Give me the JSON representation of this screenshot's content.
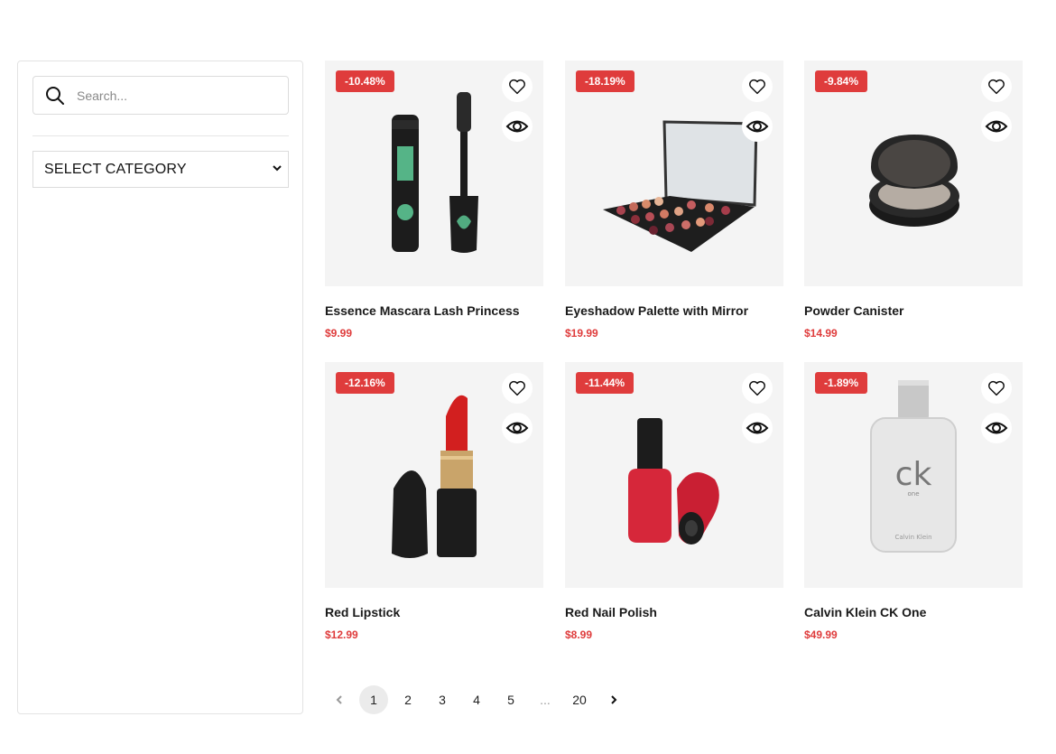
{
  "sidebar": {
    "search_placeholder": "Search...",
    "category_select": "SELECT CATEGORY"
  },
  "products": [
    {
      "name": "Essence Mascara Lash Princess",
      "price": "$9.99",
      "discount": "-10.48%",
      "icon": "mascara"
    },
    {
      "name": "Eyeshadow Palette with Mirror",
      "price": "$19.99",
      "discount": "-18.19%",
      "icon": "eyeshadow-palette"
    },
    {
      "name": "Powder Canister",
      "price": "$14.99",
      "discount": "-9.84%",
      "icon": "powder-compact"
    },
    {
      "name": "Red Lipstick",
      "price": "$12.99",
      "discount": "-12.16%",
      "icon": "lipstick"
    },
    {
      "name": "Red Nail Polish",
      "price": "$8.99",
      "discount": "-11.44%",
      "icon": "nail-polish"
    },
    {
      "name": "Calvin Klein CK One",
      "price": "$49.99",
      "discount": "-1.89%",
      "icon": "perfume-bottle",
      "bottle_text": {
        "logo": "ck",
        "sub": "one",
        "brand": "Calvin Klein"
      }
    }
  ],
  "pagination": {
    "prev_icon": "chevron-left-icon",
    "pages": [
      "1",
      "2",
      "3",
      "4",
      "5",
      "...",
      "20"
    ],
    "current": "1",
    "next_icon": "chevron-right-icon"
  },
  "colors": {
    "accent": "#df3c3c",
    "image_bg": "#f4f4f4"
  }
}
